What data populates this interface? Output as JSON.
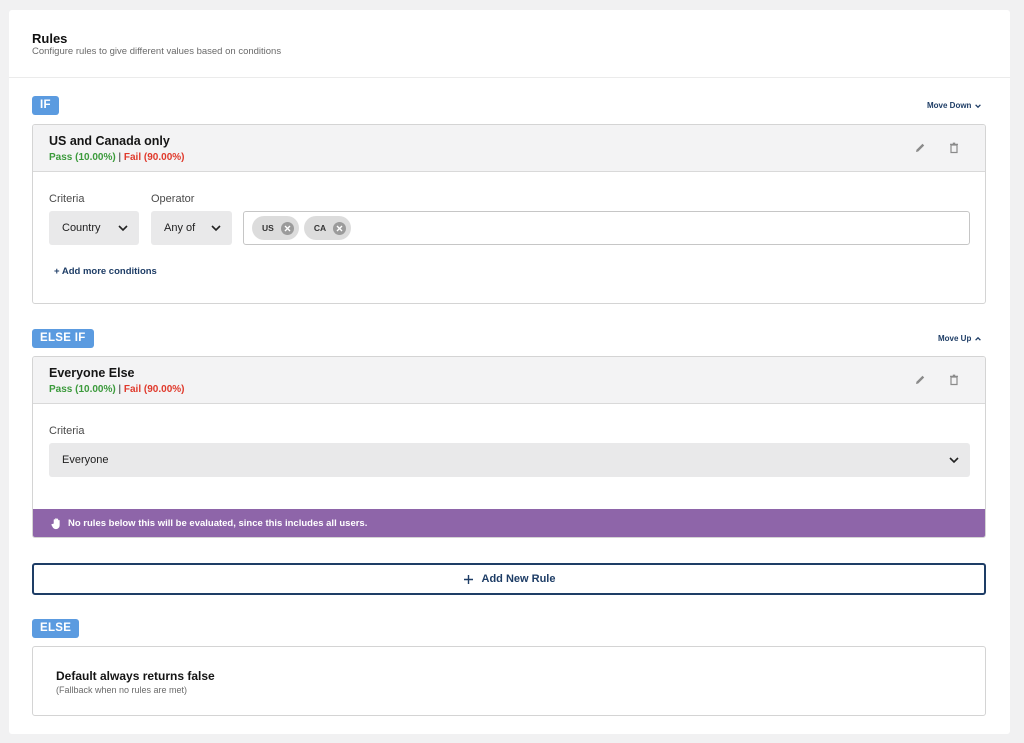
{
  "header": {
    "title": "Rules",
    "subtitle": "Configure rules to give different values based on conditions"
  },
  "rules": [
    {
      "badge": "IF",
      "move_label": "Move Down",
      "name": "US and Canada only",
      "pass": "Pass (10.00%)",
      "separator": "|",
      "fail": "Fail (90.00%)",
      "criteria_label": "Criteria",
      "criteria_value": "Country",
      "operator_label": "Operator",
      "operator_value": "Any of",
      "tags": [
        "US",
        "CA"
      ],
      "add_conditions": "+ Add more conditions"
    },
    {
      "badge": "ELSE IF",
      "move_label": "Move Up",
      "name": "Everyone Else",
      "pass": "Pass (10.00%)",
      "separator": "|",
      "fail": "Fail (90.00%)",
      "criteria_label": "Criteria",
      "criteria_value": "Everyone",
      "notice": "No rules below this will be evaluated, since this includes all users."
    }
  ],
  "add_rule_label": "Add New Rule",
  "else_block": {
    "badge": "ELSE",
    "title": "Default always returns false",
    "subtitle": "(Fallback when no rules are met)"
  },
  "colors": {
    "badge": "#5b9be0",
    "link": "#1e3d66",
    "pass": "#3b9a3b",
    "fail": "#e0392b",
    "notice": "#8e65a9"
  },
  "icons": [
    "chevron-down-icon",
    "chevron-up-icon",
    "pencil-icon",
    "trash-icon",
    "close-circle-icon",
    "hand-icon",
    "plus-icon"
  ]
}
